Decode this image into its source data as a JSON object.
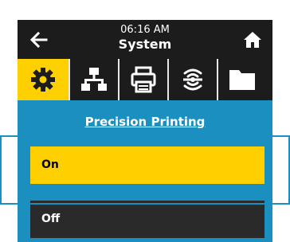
{
  "header": {
    "time": "06:16 AM",
    "title": "System",
    "back_icon": "left-arrow-icon",
    "home_icon": "home-icon"
  },
  "tabs": [
    {
      "icon": "gear-icon",
      "active": true
    },
    {
      "icon": "network-icon",
      "active": false
    },
    {
      "icon": "printer-icon",
      "active": false
    },
    {
      "icon": "rfid-icon",
      "active": false
    },
    {
      "icon": "folder-icon",
      "active": false
    }
  ],
  "section": {
    "title": "Precision Printing"
  },
  "options": [
    {
      "label": "On",
      "selected": true
    },
    {
      "label": "Off",
      "selected": false
    }
  ],
  "colors": {
    "accent": "#ffd000",
    "section_blue": "#1a8fc0",
    "dark": "#1c1c1c"
  }
}
